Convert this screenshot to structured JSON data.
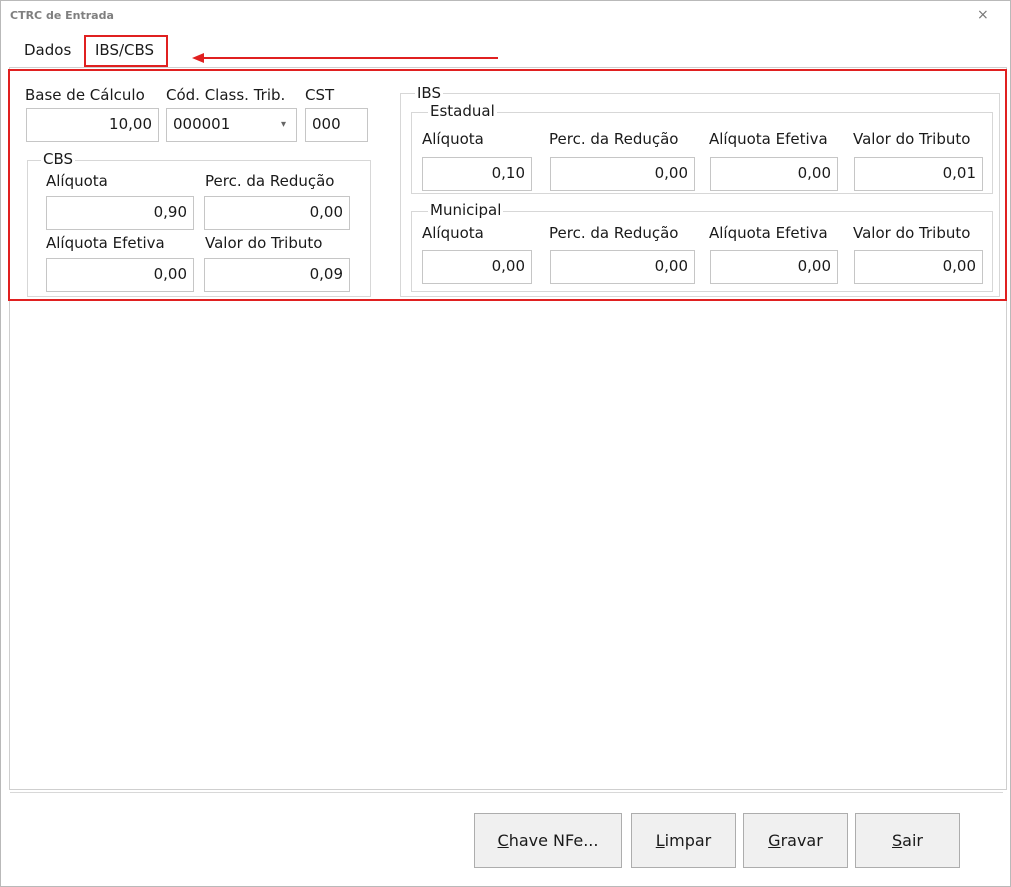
{
  "window": {
    "title": "CTRC de Entrada",
    "close_glyph": "×"
  },
  "tabs": [
    {
      "label": "Dados",
      "selected": false
    },
    {
      "label": "IBS/CBS",
      "selected": true
    }
  ],
  "base": {
    "base_calculo_label": "Base de Cálculo",
    "base_calculo_value": "10,00",
    "cod_class_label": "Cód. Class. Trib.",
    "cod_class_value": "000001",
    "cod_class_arrow": "▾",
    "cst_label": "CST",
    "cst_value": "000"
  },
  "cbs": {
    "legend": "CBS",
    "aliquota_label": "Alíquota",
    "aliquota_value": "0,90",
    "perc_reducao_label": "Perc. da Redução",
    "perc_reducao_value": "0,00",
    "aliquota_efetiva_label": "Alíquota Efetiva",
    "aliquota_efetiva_value": "0,00",
    "valor_tributo_label": "Valor do Tributo",
    "valor_tributo_value": "0,09"
  },
  "ibs": {
    "legend": "IBS",
    "estadual": {
      "legend": "Estadual",
      "aliquota_label": "Alíquota",
      "aliquota_value": "0,10",
      "perc_reducao_label": "Perc. da Redução",
      "perc_reducao_value": "0,00",
      "aliquota_efetiva_label": "Alíquota Efetiva",
      "aliquota_efetiva_value": "0,00",
      "valor_tributo_label": "Valor do Tributo",
      "valor_tributo_value": "0,01"
    },
    "municipal": {
      "legend": "Municipal",
      "aliquota_label": "Alíquota",
      "aliquota_value": "0,00",
      "perc_reducao_label": "Perc. da Redução",
      "perc_reducao_value": "0,00",
      "aliquota_efetiva_label": "Alíquota Efetiva",
      "aliquota_efetiva_value": "0,00",
      "valor_tributo_label": "Valor do Tributo",
      "valor_tributo_value": "0,00"
    }
  },
  "buttons": {
    "chave_nfe": {
      "mnemonic": "C",
      "rest": "have NFe..."
    },
    "limpar": {
      "mnemonic": "L",
      "rest": "impar"
    },
    "gravar": {
      "mnemonic": "G",
      "rest": "ravar"
    },
    "sair": {
      "mnemonic": "S",
      "rest": "air"
    }
  },
  "annotation": {
    "highlight_color": "#e02020"
  }
}
